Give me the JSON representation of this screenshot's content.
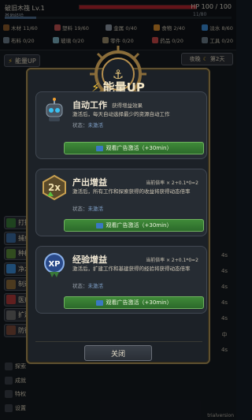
{
  "header": {
    "ship_name": "破旧木筏 Lv.1",
    "hp_text": "HP 100 / 100",
    "hp_fraction": 1.0,
    "sub_label": "基地经验",
    "xp_text": "11/80",
    "xp_fraction": 0.14
  },
  "resources_row1": [
    {
      "icon": "wood-icon",
      "label": "木材 11/60",
      "color": "#8b5a2b"
    },
    {
      "icon": "plastic-icon",
      "label": "塑料 19/60",
      "color": "#c05050"
    },
    {
      "icon": "metal-icon",
      "label": "金属 0/40",
      "color": "#8f9aa6"
    },
    {
      "icon": "food-icon",
      "label": "食物 2/40",
      "color": "#d68a2a"
    },
    {
      "icon": "water-icon",
      "label": "淡水 8/60",
      "color": "#3a8ad6"
    }
  ],
  "resources_row2": [
    {
      "icon": "fabric-icon",
      "label": "布料 0/20",
      "color": "#6c7d8a"
    },
    {
      "icon": "glass-icon",
      "label": "玻璃 0/20",
      "color": "#7ab0c0"
    },
    {
      "icon": "parts-icon",
      "label": "零件 0/20",
      "color": "#9a8a6a"
    },
    {
      "icon": "medicine-icon",
      "label": "药品 0/20",
      "color": "#c84848"
    },
    {
      "icon": "tool-icon",
      "label": "工具 0/20",
      "color": "#6a7a88"
    }
  ],
  "top_left_button": "能量UP",
  "night_label": "夜晚",
  "day_label": "第2天",
  "side_buttons": [
    "打捞",
    "捕鱼",
    "种植",
    "净水",
    "制造",
    "医疗",
    "扩建",
    "防御"
  ],
  "bottom_buttons": [
    "探索",
    "成就",
    "特权",
    "设置"
  ],
  "right_cells": [
    "4s",
    "4s",
    "4s",
    "4s",
    "4s",
    "中",
    "4s"
  ],
  "panel": {
    "title": "能量UP"
  },
  "cards": [
    {
      "icon": "robot-icon",
      "title": "自动工作",
      "sub": "获得增益效果",
      "rate": "",
      "desc": "激活后，每天自动选择最少的资源自动工作",
      "status_label": "状态：",
      "status_value": "未激活",
      "button_label": "观看广告激活（+30min）"
    },
    {
      "icon": "double-output-icon",
      "title": "产出增益",
      "sub": "",
      "rate": "当前倍率 × 2+0.1*0=2",
      "desc": "激活后，所有工作和探索获得的收益将获得动态倍率",
      "status_label": "状态：",
      "status_value": "未激活",
      "button_label": "观看广告激活（+30min）"
    },
    {
      "icon": "xp-icon",
      "title": "经验增益",
      "sub": "",
      "rate": "当前倍率 × 2+0.1*0=2",
      "desc": "激活后，扩建工作和基建获得的经验将获得动态倍率",
      "status_label": "状态：",
      "status_value": "未激活",
      "button_label": "观看广告激活（+30min）"
    }
  ],
  "close_label": "关闭",
  "trial_label": "trialversion"
}
